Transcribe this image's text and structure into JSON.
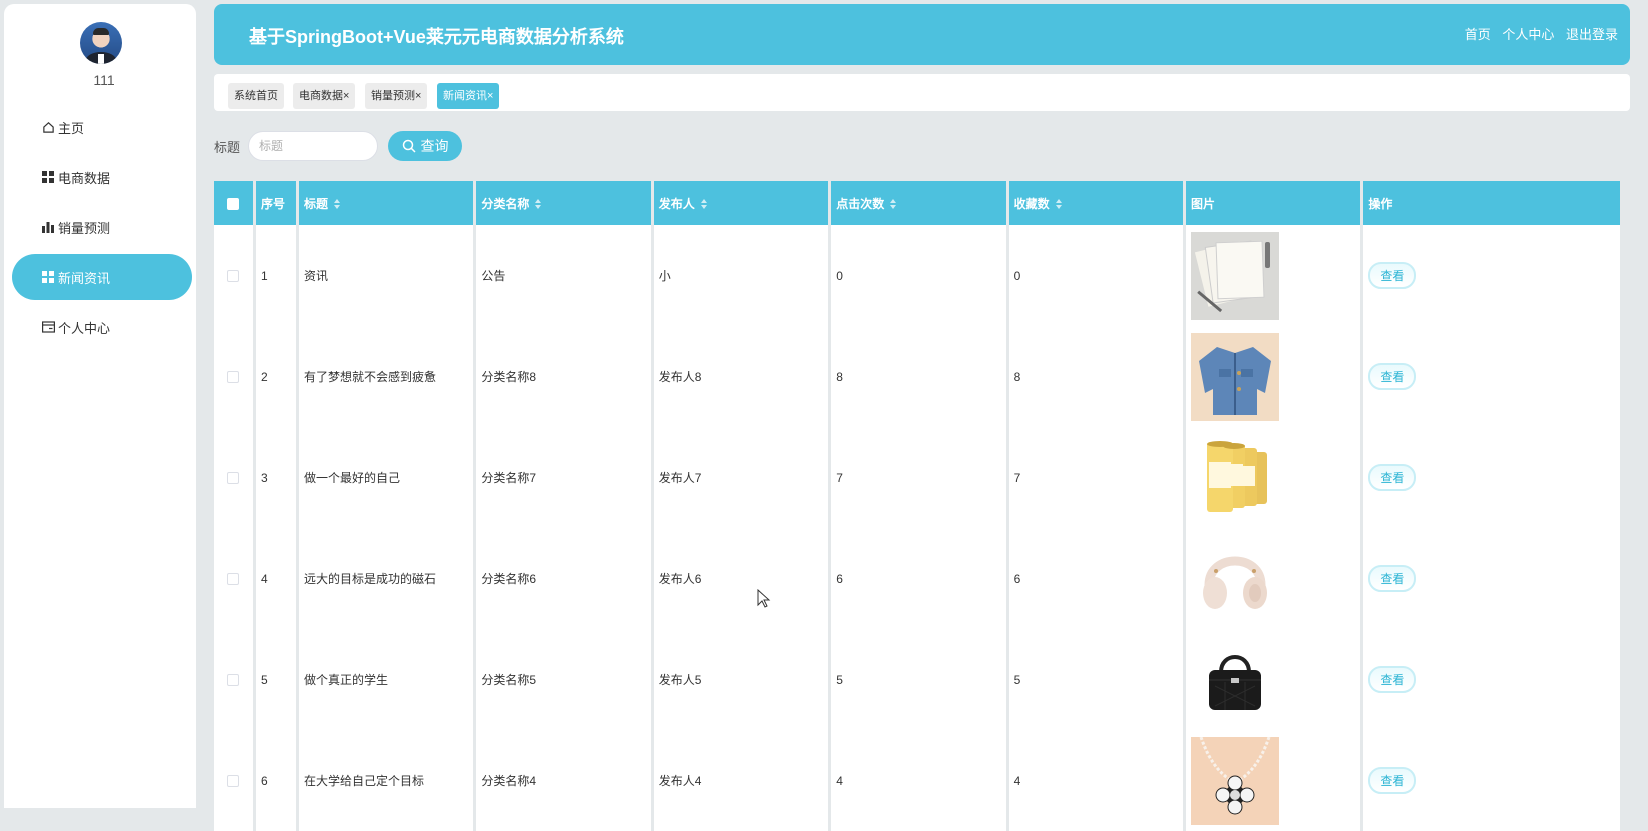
{
  "sidebar": {
    "username": "111",
    "items": [
      {
        "label": "主页",
        "icon": "home-icon",
        "active": false
      },
      {
        "label": "电商数据",
        "icon": "grid-icon",
        "active": false
      },
      {
        "label": "销量预测",
        "icon": "bar-chart-icon",
        "active": false
      },
      {
        "label": "新闻资讯",
        "icon": "grid-icon",
        "active": true
      },
      {
        "label": "个人中心",
        "icon": "card-icon",
        "active": false
      }
    ]
  },
  "header": {
    "title": "基于SpringBoot+Vue莱元元电商数据分析系统",
    "links": [
      "首页",
      "个人中心",
      "退出登录"
    ]
  },
  "tags": [
    {
      "label": "系统首页",
      "closable": false,
      "active": false
    },
    {
      "label": "电商数据",
      "closable": true,
      "active": false
    },
    {
      "label": "销量预测",
      "closable": true,
      "active": false
    },
    {
      "label": "新闻资讯",
      "closable": true,
      "active": true
    }
  ],
  "search": {
    "label": "标题",
    "placeholder": "标题",
    "value": "",
    "button": "查询"
  },
  "table": {
    "columns": [
      "序号",
      "标题",
      "分类名称",
      "发布人",
      "点击次数",
      "收藏数",
      "图片",
      "操作"
    ],
    "action_label": "查看",
    "rows": [
      {
        "index": "1",
        "title": "资讯",
        "category": "公告",
        "publisher": "小",
        "clicks": "0",
        "favorites": "0",
        "image": "notebooks"
      },
      {
        "index": "2",
        "title": "有了梦想就不会感到疲惫",
        "category": "分类名称8",
        "publisher": "发布人8",
        "clicks": "8",
        "favorites": "8",
        "image": "denim-jacket"
      },
      {
        "index": "3",
        "title": "做一个最好的自己",
        "category": "分类名称7",
        "publisher": "发布人7",
        "clicks": "7",
        "favorites": "7",
        "image": "milk-powder-cans"
      },
      {
        "index": "4",
        "title": "远大的目标是成功的磁石",
        "category": "分类名称6",
        "publisher": "发布人6",
        "clicks": "6",
        "favorites": "6",
        "image": "headphones"
      },
      {
        "index": "5",
        "title": "做个真正的学生",
        "category": "分类名称5",
        "publisher": "发布人5",
        "clicks": "5",
        "favorites": "5",
        "image": "black-handbag"
      },
      {
        "index": "6",
        "title": "在大学给自己定个目标",
        "category": "分类名称4",
        "publisher": "发布人4",
        "clicks": "4",
        "favorites": "4",
        "image": "flower-necklace"
      }
    ]
  },
  "colors": {
    "accent": "#4dc1de",
    "background": "#e4e8ea"
  }
}
